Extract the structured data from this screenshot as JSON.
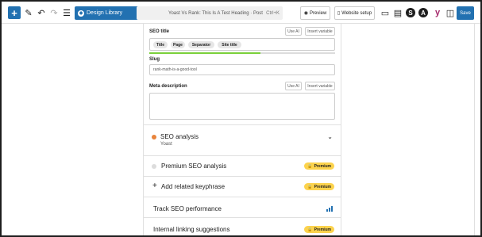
{
  "toolbar": {
    "design_library_label": "Design Library",
    "document_title": "Yoast Vs Rank: This Is A Test Heading · Post",
    "shortcut": "Ctrl+K",
    "preview_label": "Preview",
    "website_setup_label": "Website setup",
    "save_label": "Save",
    "plugin_icons": [
      "S",
      "A",
      "y"
    ]
  },
  "seo_title": {
    "label": "SEO title",
    "use_ai": "Use AI",
    "insert_variable": "Insert variable",
    "pills": [
      "Title",
      "Page",
      "Separator",
      "Site title"
    ],
    "progress": 0.6
  },
  "slug": {
    "label": "Slug",
    "value": "rank-math-is-a-good-tool"
  },
  "meta_description": {
    "label": "Meta description",
    "use_ai": "Use AI",
    "insert_variable": "Insert variable"
  },
  "sections": {
    "seo_analysis": {
      "title": "SEO analysis",
      "sub": "Yoast"
    },
    "premium_seo": {
      "title": "Premium SEO analysis",
      "badge": "Premium"
    },
    "related_keyphrase": {
      "title": "Add related keyphrase",
      "badge": "Premium"
    },
    "track_performance": {
      "title": "Track SEO performance"
    },
    "internal_linking": {
      "title": "Internal linking suggestions",
      "badge": "Premium"
    }
  },
  "colors": {
    "accent": "#2271b1",
    "progress": "#7ad03a",
    "seo_status": "#e8843c",
    "premium_badge": "#fcd34d"
  }
}
